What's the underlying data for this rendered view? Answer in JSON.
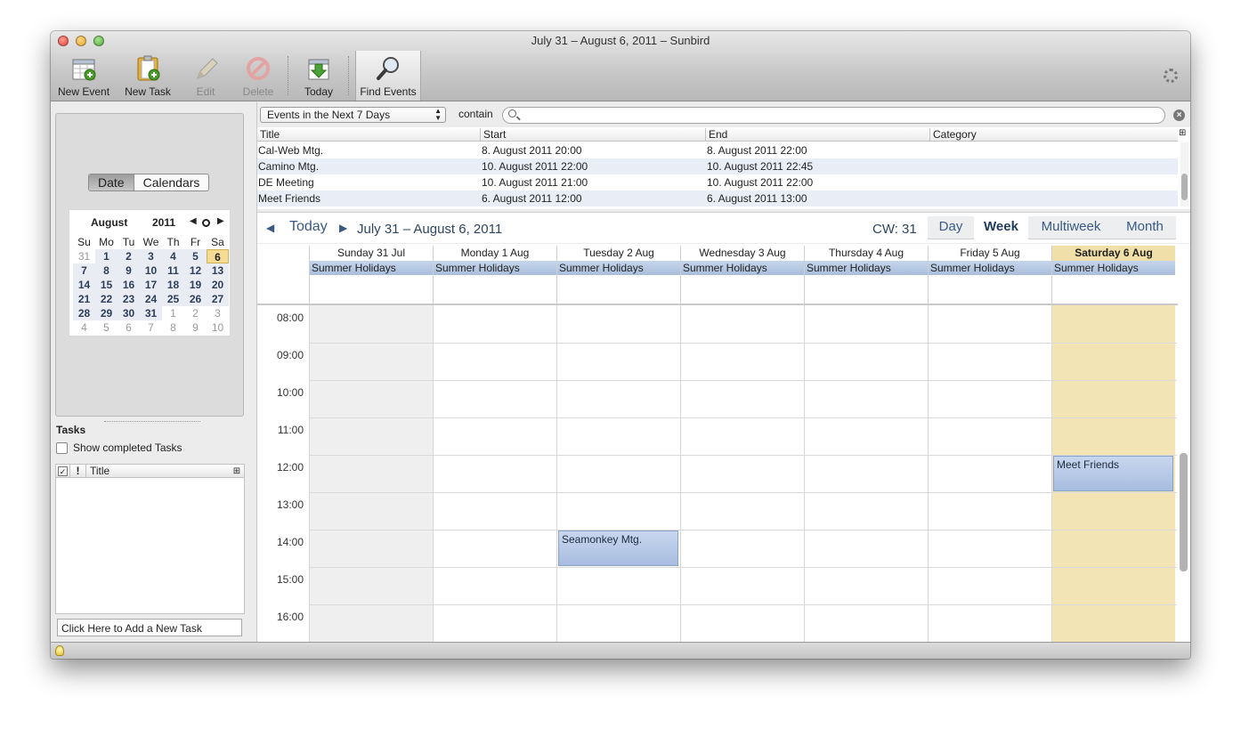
{
  "window": {
    "title": "July 31 – August 6, 2011 – Sunbird"
  },
  "toolbar": {
    "new_event": "New Event",
    "new_task": "New Task",
    "edit": "Edit",
    "delete": "Delete",
    "today": "Today",
    "find_events": "Find Events"
  },
  "sidebar": {
    "tabs": [
      "Date",
      "Calendars"
    ],
    "minimonth": {
      "month": "August",
      "year": "2011",
      "weekdays": [
        "Su",
        "Mo",
        "Tu",
        "We",
        "Th",
        "Fr",
        "Sa"
      ],
      "weeks": [
        [
          "31",
          "1",
          "2",
          "3",
          "4",
          "5",
          "6"
        ],
        [
          "7",
          "8",
          "9",
          "10",
          "11",
          "12",
          "13"
        ],
        [
          "14",
          "15",
          "16",
          "17",
          "18",
          "19",
          "20"
        ],
        [
          "21",
          "22",
          "23",
          "24",
          "25",
          "26",
          "27"
        ],
        [
          "28",
          "29",
          "30",
          "31",
          "1",
          "2",
          "3"
        ],
        [
          "4",
          "5",
          "6",
          "7",
          "8",
          "9",
          "10"
        ]
      ],
      "selected_day": "6"
    },
    "tasks_heading": "Tasks",
    "show_completed": "Show completed Tasks",
    "task_columns": {
      "priority": "!",
      "title": "Title"
    },
    "new_task_placeholder": "Click Here to Add a New Task"
  },
  "search": {
    "filter": "Events in the Next 7 Days",
    "contain_label": "contain",
    "query": ""
  },
  "event_list": {
    "columns": [
      "Title",
      "Start",
      "End",
      "Category"
    ],
    "rows": [
      {
        "title": "Cal-Web Mtg.",
        "start": "8. August 2011 20:00",
        "end": "8. August 2011 22:00",
        "category": ""
      },
      {
        "title": "Camino Mtg.",
        "start": "10. August 2011 22:00",
        "end": "10. August 2011 22:45",
        "category": ""
      },
      {
        "title": "DE Meeting",
        "start": "10. August 2011 21:00",
        "end": "10. August 2011 22:00",
        "category": ""
      },
      {
        "title": "Meet Friends",
        "start": "6. August 2011 12:00",
        "end": "6. August 2011 13:00",
        "category": ""
      }
    ]
  },
  "calendar": {
    "today_label": "Today",
    "range": "July 31 – August 6, 2011",
    "cw": "CW: 31",
    "views": [
      "Day",
      "Week",
      "Multiweek",
      "Month"
    ],
    "active_view": "Week",
    "days": [
      "Sunday 31 Jul",
      "Monday 1 Aug",
      "Tuesday 2 Aug",
      "Wednesday 3 Aug",
      "Thursday 4 Aug",
      "Friday 5 Aug",
      "Saturday 6 Aug"
    ],
    "allday_event": "Summer Holidays",
    "hours": [
      "08:00",
      "09:00",
      "10:00",
      "11:00",
      "12:00",
      "13:00",
      "14:00",
      "15:00",
      "16:00"
    ],
    "events": [
      {
        "title": "Seamonkey Mtg.",
        "day": "Tuesday 2 Aug",
        "start": "14:00",
        "end": "15:00"
      },
      {
        "title": "Meet Friends",
        "day": "Saturday 6 Aug",
        "start": "12:00",
        "end": "13:00"
      }
    ]
  },
  "colors": {
    "selected_day": "#f3e4b5",
    "event": "#b6c9e4",
    "nav_text": "#3a5a84"
  }
}
